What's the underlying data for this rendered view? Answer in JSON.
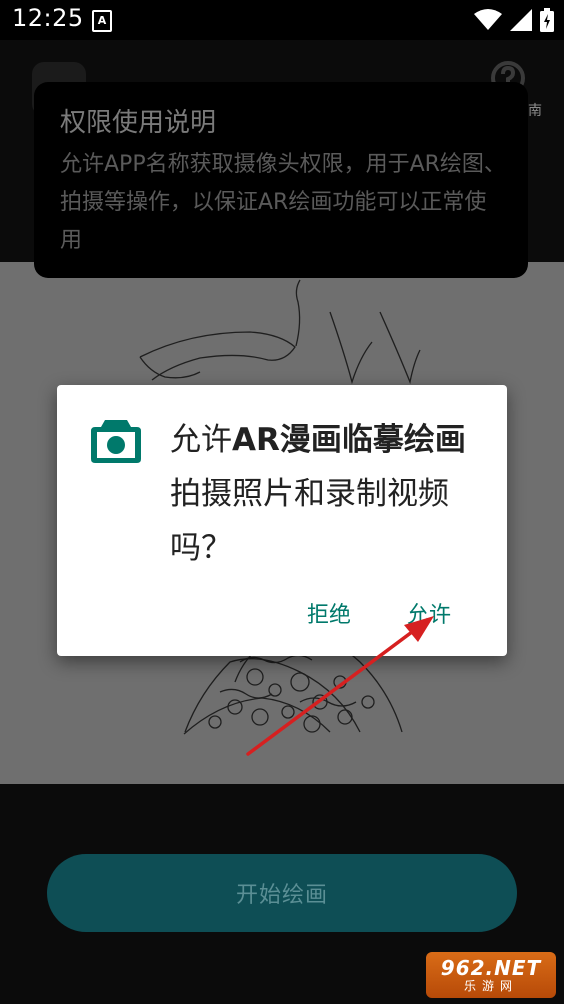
{
  "status_bar": {
    "time": "12:25",
    "notification_glyph": "A",
    "icons": [
      "wifi-icon",
      "signal-icon",
      "battery-charging-icon"
    ]
  },
  "app": {
    "help_label": "南",
    "start_button_label": "开始绘画"
  },
  "permission_banner": {
    "title": "权限使用说明",
    "description": "允许APP名称获取摄像头权限，用于AR绘图、拍摄等操作，以保证AR绘画功能可以正常使用"
  },
  "dialog": {
    "icon": "camera-icon",
    "message_prefix": "允许",
    "app_name": "AR漫画临摹绘画",
    "message_suffix": "拍摄照片和录制视频吗？",
    "deny_label": "拒绝",
    "allow_label": "允许"
  },
  "annotation": {
    "arrow_color": "#d62020",
    "arrow_target": "allow-button"
  },
  "watermark": {
    "brand": "962.NET",
    "subtitle": "乐游网"
  },
  "colors": {
    "accent": "#00796b",
    "start_button": "#0e4e55"
  }
}
